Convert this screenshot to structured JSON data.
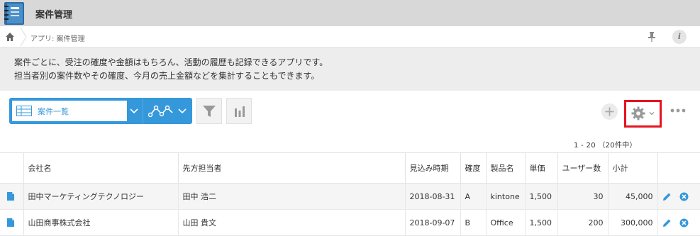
{
  "app": {
    "title": "案件管理"
  },
  "breadcrumb": {
    "text": "アプリ: 案件管理"
  },
  "description": {
    "lines": [
      "案件ごとに、受注の確度や金額はもちろん、活動の履歴も記録できるアプリです。",
      "担当者別の案件数やその確度、今月の売上金額などを集計することもできます。"
    ]
  },
  "toolbar": {
    "view_label": "案件一覧",
    "icons": {
      "graph": "graph-icon",
      "filter": "filter-icon",
      "chart": "bar-chart-icon",
      "add": "plus-icon",
      "settings": "gear-icon",
      "more": "more-icon"
    },
    "highlight_color": "#e5141f",
    "accent_color": "#3498db"
  },
  "paging": {
    "text": "1 - 20 （20件中）"
  },
  "table": {
    "headers": [
      "会社名",
      "先方担当者",
      "見込み時期",
      "確度",
      "製品名",
      "単価",
      "ユーザー数",
      "小計"
    ],
    "rows": [
      {
        "company": "田中マーケティングテクノロジー",
        "contact": "田中 浩二",
        "date": "2018-08-31",
        "prob": "A",
        "product": "kintone",
        "price": "1,500",
        "users": "30",
        "subtotal": "45,000"
      },
      {
        "company": "山田商事株式会社",
        "contact": "山田 貴文",
        "date": "2018-09-07",
        "prob": "B",
        "product": "Office",
        "price": "1,500",
        "users": "200",
        "subtotal": "300,000"
      }
    ]
  }
}
